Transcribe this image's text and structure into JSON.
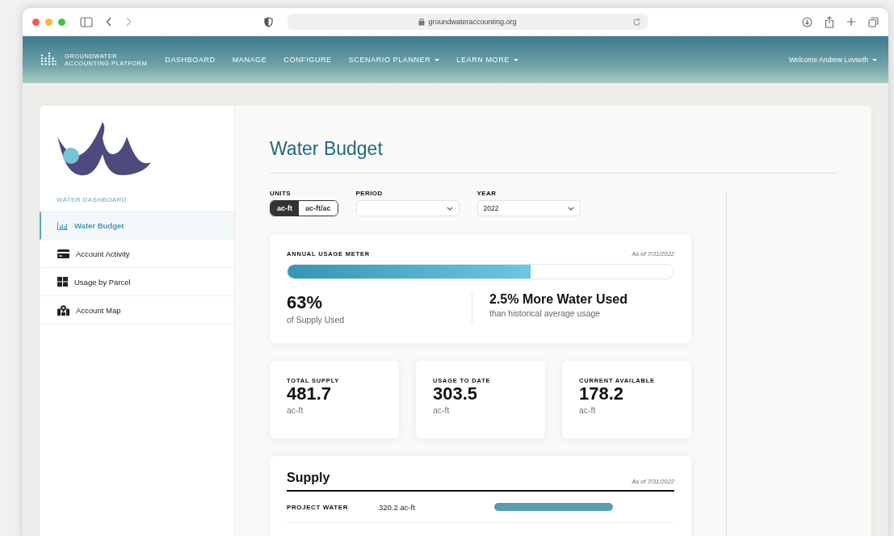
{
  "browser": {
    "url": "groundwateraccounting.org"
  },
  "nav": {
    "brand": [
      "GROUNDWATER",
      "ACCOUNTING PLATFORM"
    ],
    "items": [
      {
        "label": "DASHBOARD",
        "dropdown": false
      },
      {
        "label": "MANAGE",
        "dropdown": false
      },
      {
        "label": "CONFIGURE",
        "dropdown": false
      },
      {
        "label": "SCENARIO PLANNER",
        "dropdown": true
      },
      {
        "label": "LEARN MORE",
        "dropdown": true
      }
    ],
    "user": {
      "label": "Welcome Andrew Lovseth",
      "dropdown": true
    }
  },
  "sidebar": {
    "heading": "WATER DASHBOARD",
    "items": [
      {
        "label": "Water Budget",
        "kind": "chart",
        "selected": true
      },
      {
        "label": "Account Activity",
        "kind": "card",
        "selected": false
      },
      {
        "label": "Usage by Parcel",
        "kind": "grid",
        "selected": false
      },
      {
        "label": "Account Map",
        "kind": "map",
        "selected": false
      }
    ]
  },
  "title": "Water Budget",
  "filters": {
    "units": {
      "label": "UNITS",
      "options": [
        {
          "label": "ac-ft",
          "selected": true
        },
        {
          "label": "ac-ft/ac",
          "selected": false
        }
      ]
    },
    "period": {
      "label": "PERIOD"
    },
    "year": {
      "label": "YEAR",
      "value": "2022"
    }
  },
  "meter": {
    "title": "ANNUAL USAGE METER",
    "as_of": "As of 7/31/2022",
    "level": 0.63,
    "percent": "63%",
    "percent_caption": "of Supply Used",
    "comparison": "2.5% More Water Used",
    "comparison_caption": "than historical average usage"
  },
  "stats": [
    {
      "label": "TOTAL SUPPLY",
      "value": "481.7",
      "unit": "ac-ft"
    },
    {
      "label": "USAGE TO DATE",
      "value": "303.5",
      "unit": "ac-ft"
    },
    {
      "label": "CURRENT AVAILABLE",
      "value": "178.2",
      "unit": "ac-ft"
    }
  ],
  "supply": {
    "title": "Supply",
    "as_of": "As of 7/31/2022",
    "rows": [
      {
        "name": "PROJECT WATER",
        "amount": "320.2 ac-ft",
        "level": 0.66
      }
    ]
  }
}
